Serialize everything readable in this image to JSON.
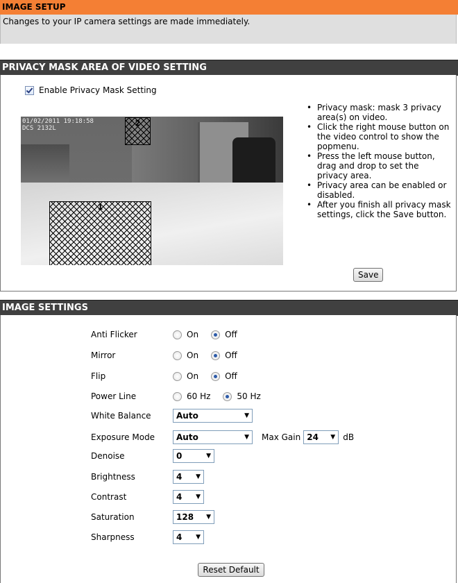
{
  "image_setup": {
    "title": "IMAGE SETUP",
    "description": "Changes to your IP camera settings are made immediately."
  },
  "privacy": {
    "title": "PRIVACY MASK AREA OF VIDEO SETTING",
    "enable_label": "Enable Privacy Mask Setting",
    "enable_checked": true,
    "video_overlay": "01/02/2011 19:18:58\nDCS 2132L",
    "mask1_label": "1",
    "mask2_label": "2",
    "tips": [
      "Privacy mask: mask 3 privacy area(s) on video.",
      "Click the right mouse button on the video control to show the popmenu.",
      "Press the left mouse button, drag and drop to set the privacy area.",
      "Privacy area can be enabled or disabled.",
      "After you finish all privacy mask settings, click the Save button."
    ],
    "save_label": "Save"
  },
  "image_settings": {
    "title": "IMAGE SETTINGS",
    "anti_flicker": {
      "label": "Anti Flicker",
      "on": "On",
      "off": "Off",
      "selected": "Off"
    },
    "mirror": {
      "label": "Mirror",
      "on": "On",
      "off": "Off",
      "selected": "Off"
    },
    "flip": {
      "label": "Flip",
      "on": "On",
      "off": "Off",
      "selected": "Off"
    },
    "power_line": {
      "label": "Power Line",
      "opt1": "60 Hz",
      "opt2": "50 Hz",
      "selected": "50 Hz"
    },
    "white_balance": {
      "label": "White Balance",
      "value": "Auto"
    },
    "exposure_mode": {
      "label": "Exposure Mode",
      "value": "Auto",
      "max_gain_label": "Max Gain",
      "max_gain_value": "24",
      "max_gain_unit": "dB"
    },
    "denoise": {
      "label": "Denoise",
      "value": "0"
    },
    "brightness": {
      "label": "Brightness",
      "value": "4"
    },
    "contrast": {
      "label": "Contrast",
      "value": "4"
    },
    "saturation": {
      "label": "Saturation",
      "value": "128"
    },
    "sharpness": {
      "label": "Sharpness",
      "value": "4"
    },
    "reset_label": "Reset Default"
  },
  "colors": {
    "orange_header": "#f47f34",
    "dark_header": "#404040",
    "description_bg": "#dfdfdf",
    "radio_selected": "#2c5aa8"
  },
  "icons": {
    "checkbox": "checkmark",
    "dropdown": "triangle-down",
    "bullet": "dot"
  }
}
